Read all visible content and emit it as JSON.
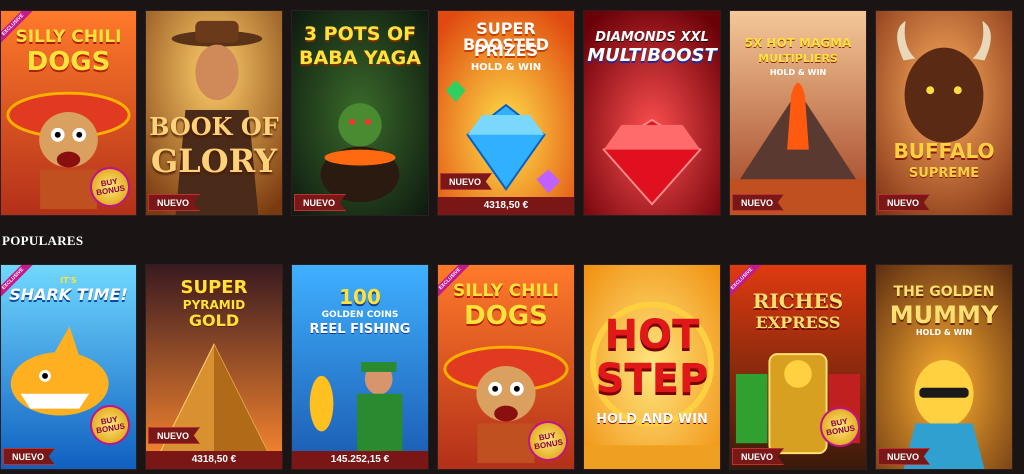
{
  "section": {
    "populares": "POPULARES"
  },
  "row1": [
    {
      "title_a": "SILLY CHILI",
      "title_b": "DOGS",
      "ribbon": "EXCLUSIVE",
      "bonus": "BUY BONUS"
    },
    {
      "title_a": "BOOK OF",
      "title_b": "GLORY",
      "badge": "NUEVO"
    },
    {
      "title_a": "3 POTS OF",
      "title_b": "BABA YAGA",
      "badge": "NUEVO"
    },
    {
      "title_a": "SUPER BOOSTED",
      "title_b": "PRIZES",
      "title_c": "HOLD & WIN",
      "badge": "NUEVO",
      "jackpot": "4318,50 €"
    },
    {
      "title_a": "DIAMONDS XXL",
      "title_b": "MULTIBOOST"
    },
    {
      "title_a": "5X HOT MAGMA",
      "title_b": "MULTIPLIERS",
      "title_c": "HOLD & WIN",
      "badge": "NUEVO"
    },
    {
      "title_a": "BUFFALO",
      "title_b": "SUPREME",
      "badge": "NUEVO"
    }
  ],
  "row2": [
    {
      "title_a": "IT'S",
      "title_b": "SHARK TIME!",
      "ribbon": "EXCLUSIVE",
      "badge": "NUEVO",
      "bonus": "BUY BONUS"
    },
    {
      "title_a": "SUPER",
      "title_b": "PYRAMID",
      "title_c": "GOLD",
      "badge": "NUEVO",
      "jackpot": "4318,50 €"
    },
    {
      "title_a": "100",
      "title_b": "GOLDEN COINS",
      "title_c": "REEL FISHING",
      "jackpot": "145.252,15 €"
    },
    {
      "title_a": "SILLY CHILI",
      "title_b": "DOGS",
      "ribbon": "EXCLUSIVE",
      "bonus": "BUY BONUS"
    },
    {
      "title_a": "HOT",
      "title_b": "STEP",
      "title_c": "HOLD AND WIN"
    },
    {
      "title_a": "RICHES",
      "title_b": "EXPRESS",
      "ribbon": "EXCLUSIVE",
      "badge": "NUEVO",
      "bonus": "BUY BONUS"
    },
    {
      "title_a": "THE GOLDEN",
      "title_b": "MUMMY",
      "title_c": "HOLD & WIN",
      "badge": "NUEVO"
    }
  ]
}
